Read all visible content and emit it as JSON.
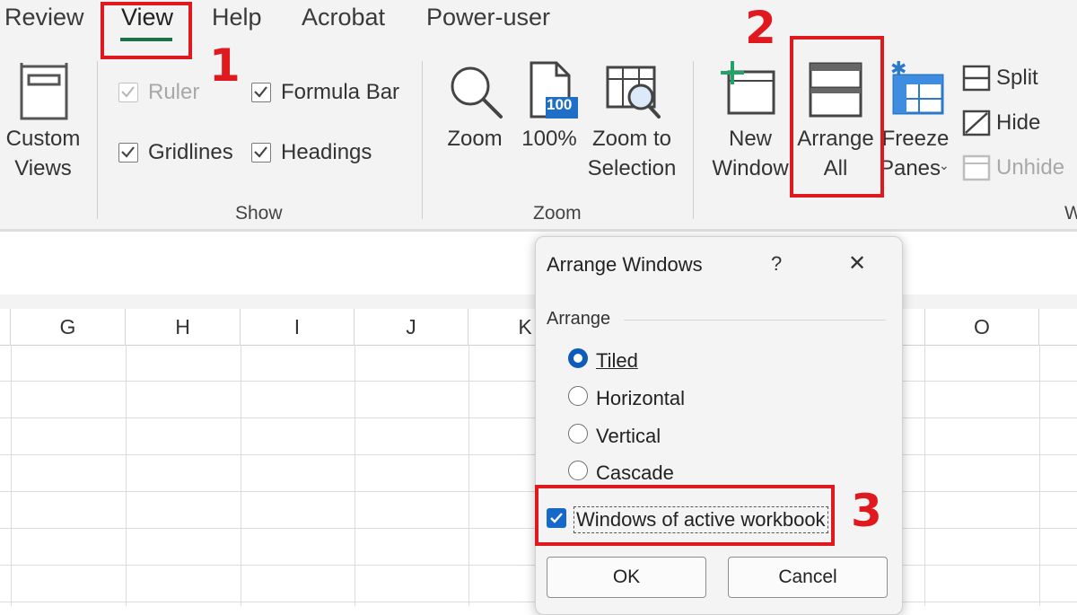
{
  "ribbon": {
    "tabs": [
      {
        "label": "Review"
      },
      {
        "label": "View",
        "active": true
      },
      {
        "label": "Help"
      },
      {
        "label": "Acrobat"
      },
      {
        "label": "Power-user"
      }
    ],
    "custom_views": {
      "line1": "Custom",
      "line2": "Views"
    },
    "show": {
      "label": "Show",
      "ruler": "Ruler",
      "formula_bar": "Formula Bar",
      "gridlines": "Gridlines",
      "headings": "Headings"
    },
    "zoom": {
      "label": "Zoom",
      "zoom_btn": "Zoom",
      "hundred_btn": "100%",
      "hundred_icon_text": "100",
      "zoom_sel_line1": "Zoom to",
      "zoom_sel_line2": "Selection"
    },
    "window": {
      "new_window_line1": "New",
      "new_window_line2": "Window",
      "arrange_line1": "Arrange",
      "arrange_line2": "All",
      "freeze_line1": "Freeze",
      "freeze_line2": "Panes",
      "split": "Split",
      "hide": "Hide",
      "unhide": "Unhide",
      "group_label_partial": "W"
    }
  },
  "annotations": {
    "step1": "1",
    "step2": "2",
    "step3": "3",
    "color": "#e0191f"
  },
  "sheet": {
    "columns": [
      "G",
      "H",
      "I",
      "J",
      "K",
      "O"
    ]
  },
  "dialog": {
    "title": "Arrange Windows",
    "help": "?",
    "close": "✕",
    "section": "Arrange",
    "options": [
      {
        "label": "Tiled",
        "selected": true
      },
      {
        "label": "Horizontal",
        "selected": false
      },
      {
        "label": "Vertical",
        "selected": false
      },
      {
        "label": "Cascade",
        "selected": false
      }
    ],
    "active_workbook": {
      "label": "Windows of active workbook",
      "checked": true
    },
    "ok": "OK",
    "cancel": "Cancel"
  },
  "colors": {
    "accent": "#0f5cb8",
    "tab_underline": "#1e7145",
    "checkbox_blue": "#1668c9"
  }
}
